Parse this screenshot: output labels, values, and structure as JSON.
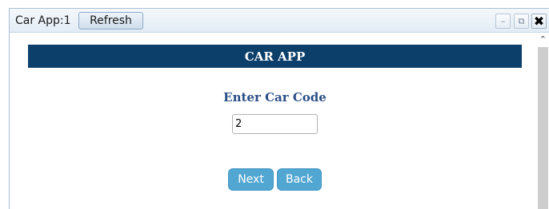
{
  "window": {
    "title": "Car App:1",
    "refresh_label": "Refresh",
    "controls": {
      "minimize_icon": "–",
      "popout_icon": "⧉",
      "close_icon": "✖"
    }
  },
  "app": {
    "header": "CAR APP",
    "prompt": "Enter Car Code",
    "car_code_value": "2",
    "next_label": "Next",
    "back_label": "Back"
  },
  "scrollbar": {
    "up_arrow_icon": "⌃"
  },
  "colors": {
    "header_bg": "#0d3f6b",
    "prompt_text": "#2a4f86",
    "button_bg": "#52a6d2"
  }
}
